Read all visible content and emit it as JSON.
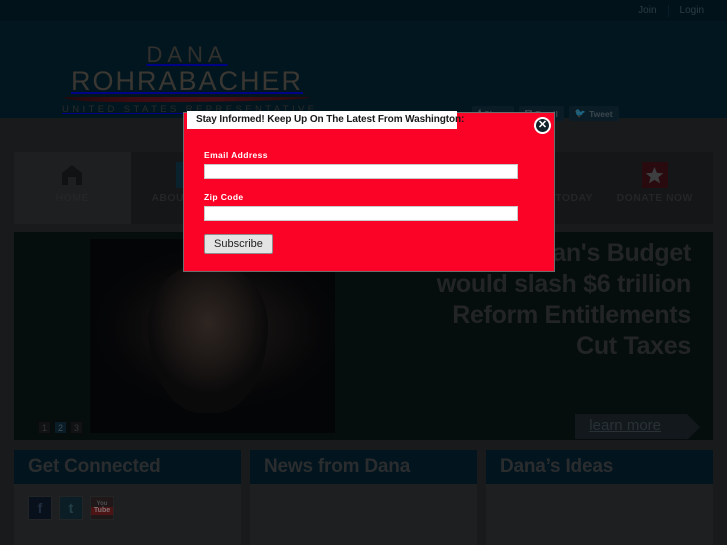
{
  "topbar": {
    "join_label": "Join",
    "login_label": "Login"
  },
  "masthead": {
    "logo_line1": "DANA",
    "logo_line2": "ROHRABACHER",
    "logo_tagline": "UNITED STATES REPRESENTATIVE",
    "share_buttons": [
      {
        "icon": "facebook-icon",
        "glyph": "f",
        "label": "Share"
      },
      {
        "icon": "email-icon",
        "glyph": "✉",
        "label": "Email"
      },
      {
        "icon": "twitter-icon",
        "glyph": "🐦",
        "label": "Tweet"
      }
    ]
  },
  "nav": {
    "items": [
      {
        "icon": "home-icon",
        "label": "HOME",
        "active": true
      },
      {
        "icon": "signature-icon",
        "label": "ABOUT DANA",
        "active": false
      },
      {
        "icon": "document-icon",
        "label": "",
        "active": false
      },
      {
        "icon": "news-icon",
        "label": "",
        "active": false
      },
      {
        "icon": "volunteer-icon",
        "label": "VOLUNTEER TODAY",
        "active": false
      },
      {
        "icon": "star-icon",
        "label": "DONATE NOW",
        "active": false
      }
    ]
  },
  "hero": {
    "headline_lines": [
      "an's Budget",
      "would slash $6 trillion",
      "Reform Entitlements",
      "Cut Taxes"
    ],
    "learn_more_label": "learn more",
    "pager": [
      {
        "label": "1",
        "active": false
      },
      {
        "label": "2",
        "active": true
      },
      {
        "label": "3",
        "active": false
      }
    ]
  },
  "columns": [
    {
      "title": "Get Connected",
      "social": [
        {
          "icon": "facebook-icon",
          "glyph": "f"
        },
        {
          "icon": "twitter-icon",
          "glyph": "t"
        },
        {
          "icon": "youtube-icon",
          "glyph": "You Tube"
        }
      ]
    },
    {
      "title": "News from Dana",
      "social": []
    },
    {
      "title": "Dana’s Ideas",
      "social": []
    }
  ],
  "modal": {
    "title": "Stay Informed! Keep Up On The Latest From Washington:",
    "close_label": "✕",
    "email_label": "Email Address",
    "email_value": "",
    "email_placeholder": "",
    "zip_label": "Zip Code",
    "zip_value": "",
    "zip_placeholder": "",
    "subscribe_label": "Subscribe"
  },
  "colors": {
    "header_navy": "#032430",
    "topbar_navy": "#031d28",
    "body_gray": "#2b2b2b",
    "panel_gray": "#343434",
    "modal_red": "#fb0326",
    "accent_crimson": "#4a1014",
    "accent_teal": "#123a4c"
  }
}
